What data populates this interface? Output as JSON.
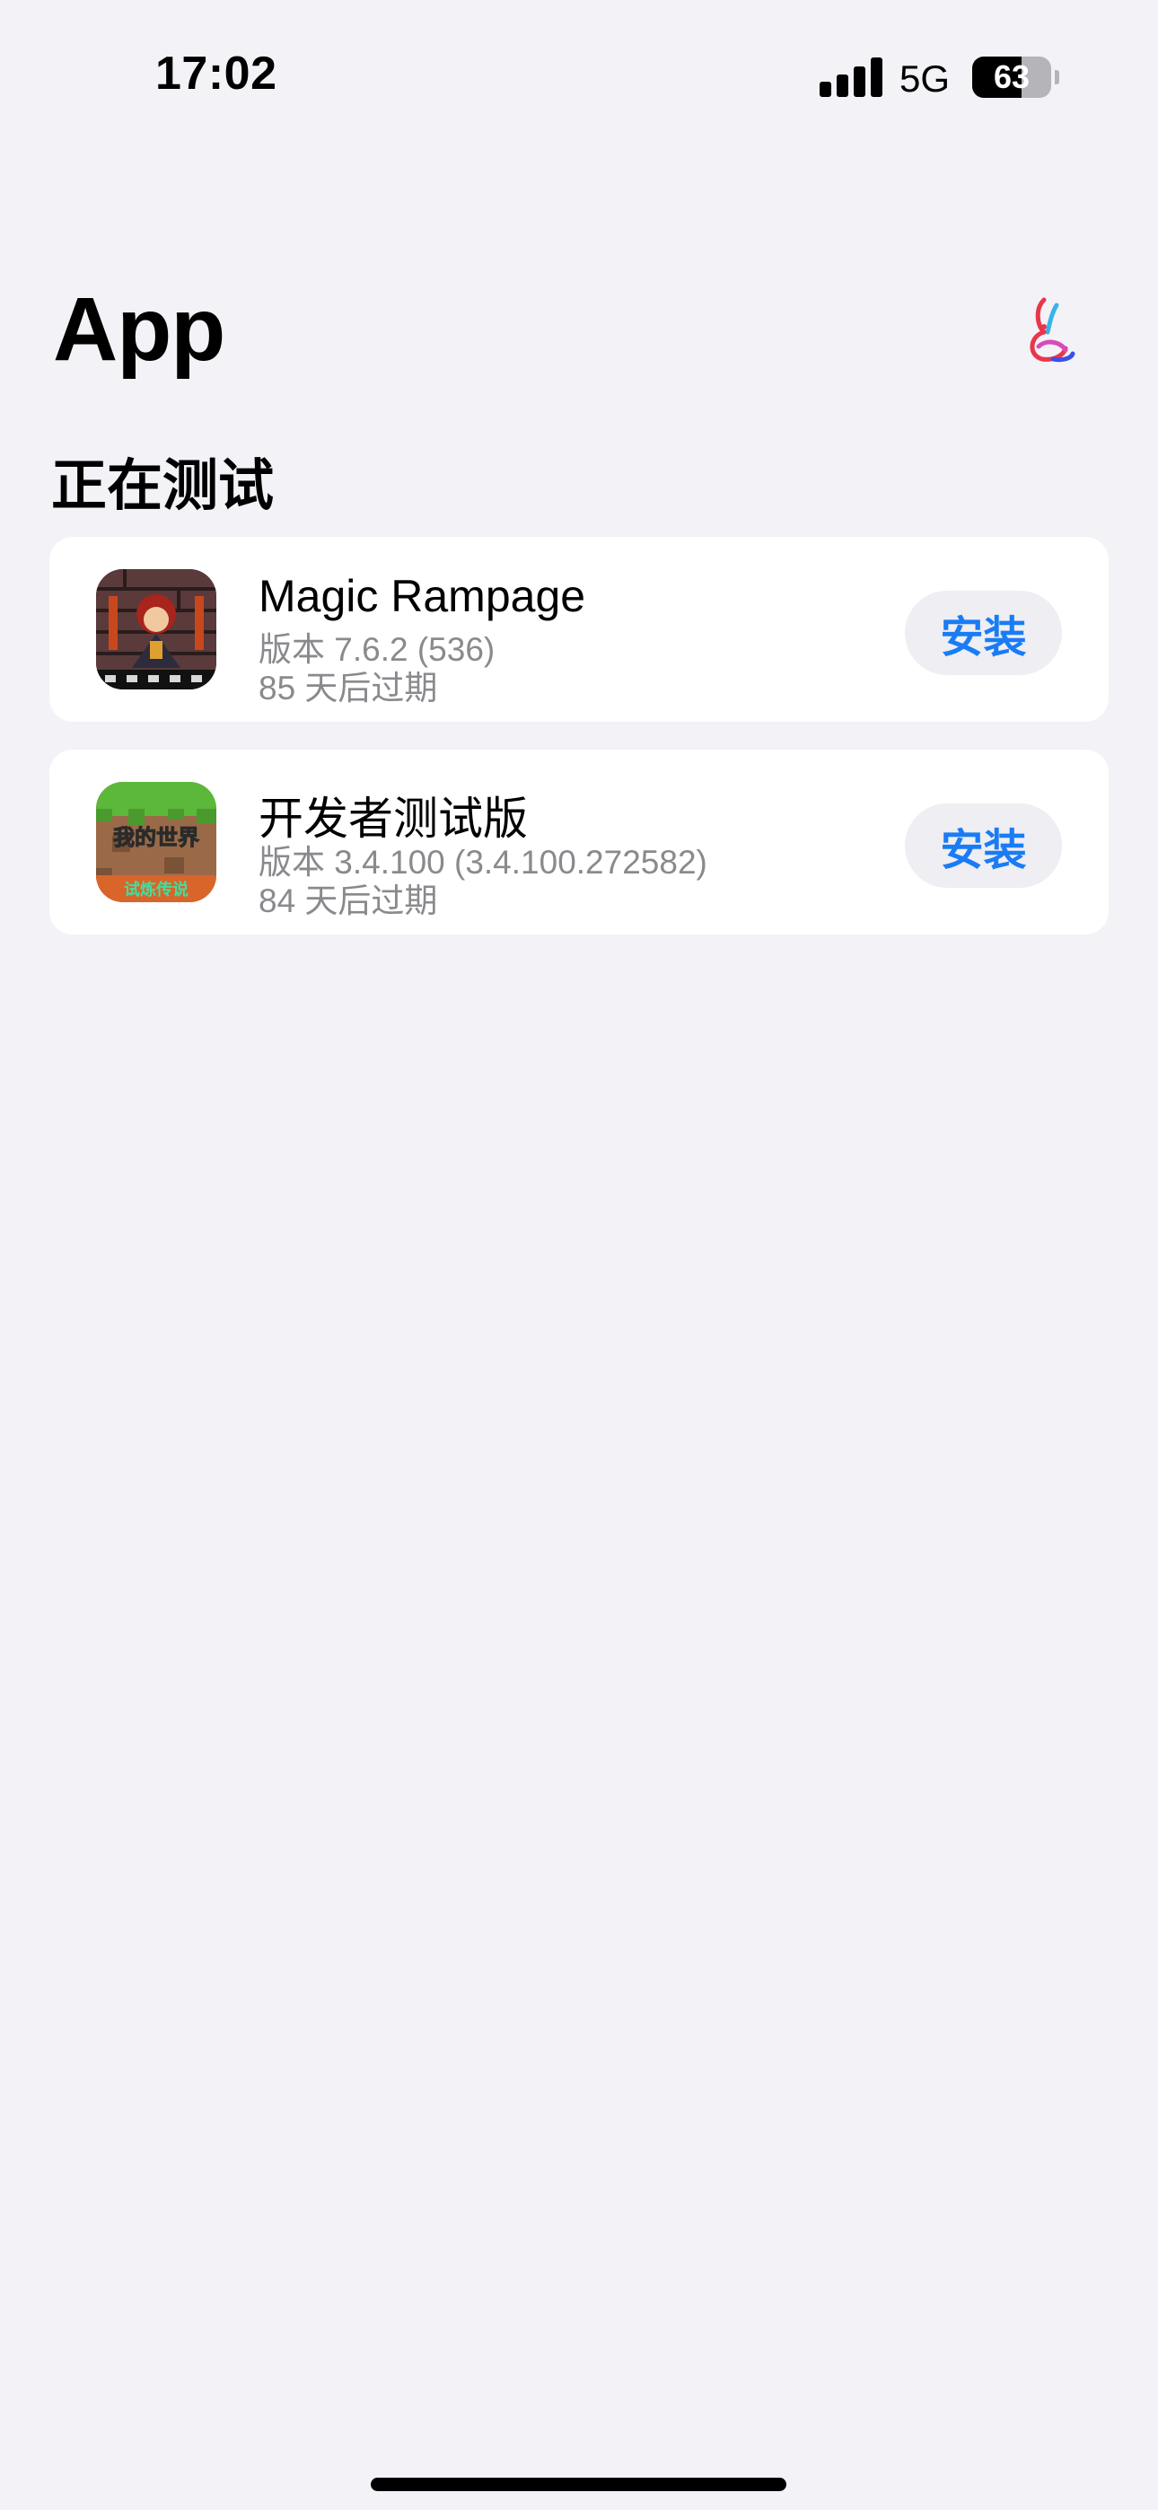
{
  "status_bar": {
    "time": "17:02",
    "network": "5G",
    "battery_level": "63",
    "battery_fraction": 0.63
  },
  "header": {
    "title": "App",
    "logo_icon": "rabbit-logo-icon"
  },
  "section": {
    "title": "正在测试"
  },
  "apps": [
    {
      "name": "Magic Rampage",
      "version": "版本 7.6.2 (536)",
      "expiry": "85 天后过期",
      "action": "安装",
      "icon": "magic-rampage-app-icon"
    },
    {
      "name": "开发者测试版",
      "version": "版本 3.4.100 (3.4.100.272582)",
      "expiry": "84 天后过期",
      "action": "安装",
      "icon": "minecraft-app-icon",
      "icon_text_top": "我的世界",
      "icon_text_bottom": "试炼传说"
    }
  ],
  "colors": {
    "background": "#f2f2f7",
    "card": "#ffffff",
    "accent": "#1a7cf5",
    "secondary_text": "#8a8a8e",
    "button_bg": "#eeeef3"
  }
}
